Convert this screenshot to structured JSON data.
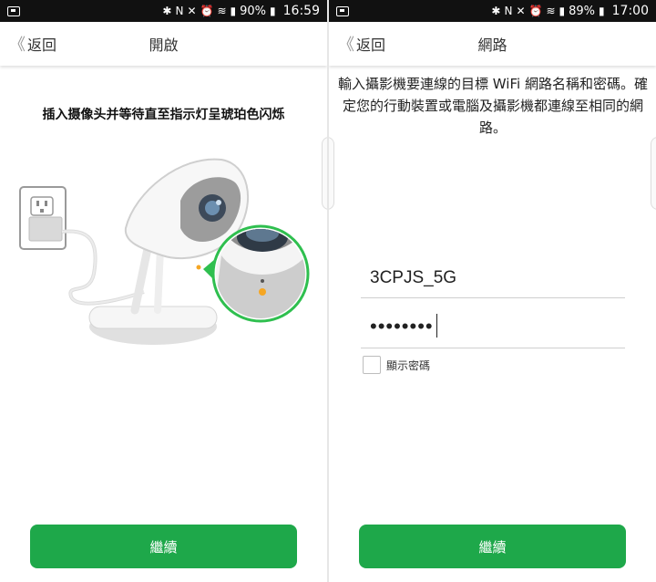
{
  "left_screen": {
    "status": {
      "battery": "90%",
      "time": "16:59"
    },
    "back_label": "返回",
    "title": "開啟",
    "instruction": "插入摄像头并等待直至指示灯呈琥珀色闪烁",
    "continue_label": "繼續"
  },
  "right_screen": {
    "status": {
      "battery": "89%",
      "time": "17:00"
    },
    "back_label": "返回",
    "title": "網路",
    "instruction": "輸入攝影機要連線的目標 WiFi 網路名稱和密碼。確定您的行動裝置或電腦及攝影機都連線至相同的網路。",
    "ssid_value": "3CPJS_5G",
    "password_masked": "••••••••",
    "show_password_label": "顯示密碼",
    "continue_label": "繼續"
  },
  "colors": {
    "accent": "#1ea84a",
    "indicator": "#f5a623"
  }
}
